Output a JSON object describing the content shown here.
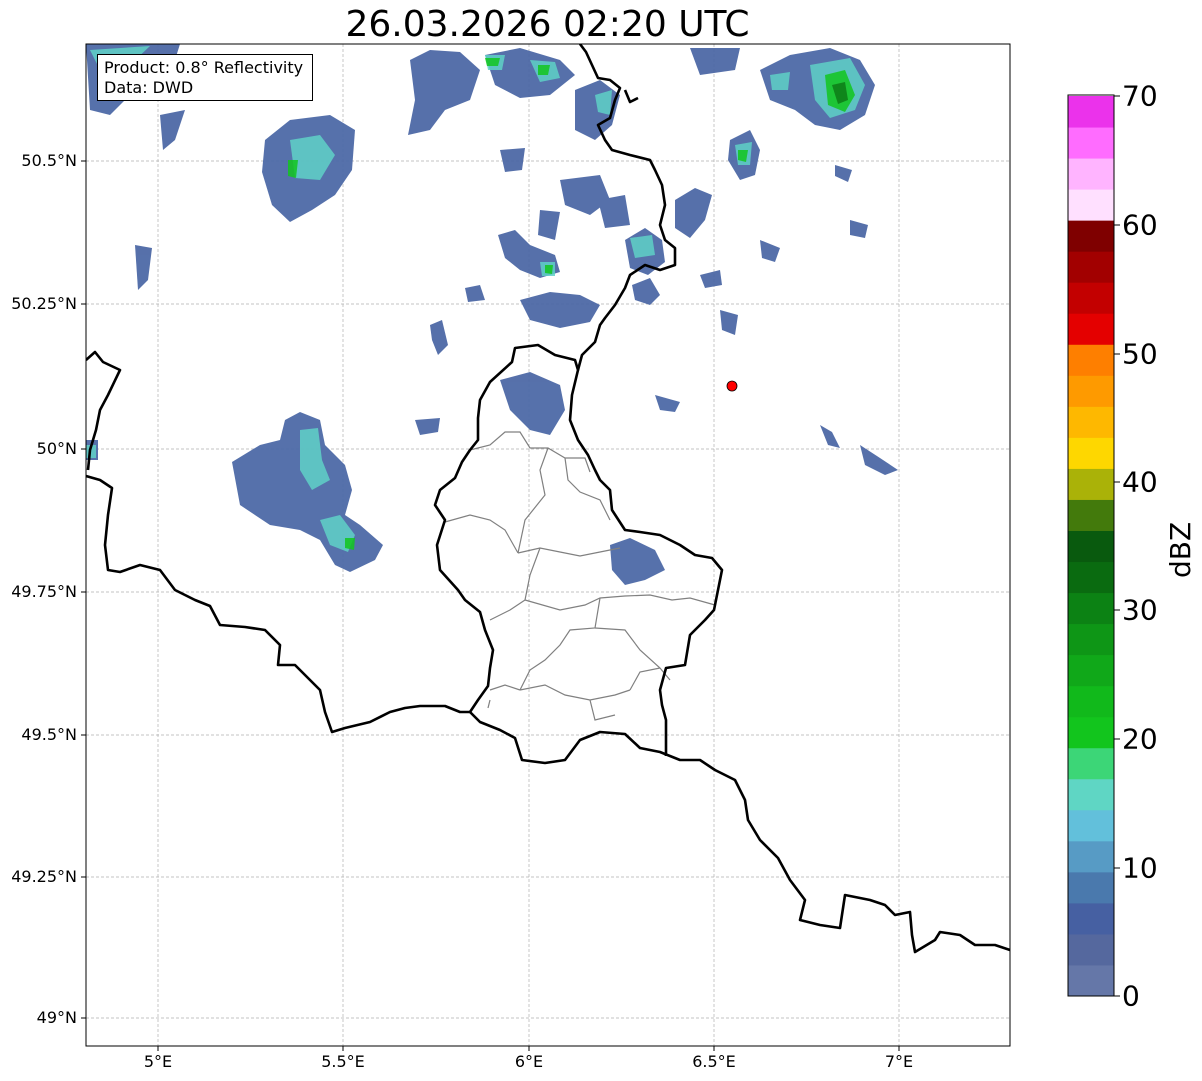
{
  "title": "26.03.2026 02:20 UTC",
  "info": {
    "product": "Product: 0.8° Reflectivity",
    "data": "Data: DWD"
  },
  "axes": {
    "x_ticks": [
      "5°E",
      "5.5°E",
      "6°E",
      "6.5°E",
      "7°E"
    ],
    "y_ticks": [
      "50.5°N",
      "50.25°N",
      "50°N",
      "49.75°N",
      "49.5°N",
      "49.25°N",
      "49°N"
    ]
  },
  "colorbar": {
    "label": "dBZ",
    "ticks": [
      "70",
      "60",
      "50",
      "40",
      "30",
      "20",
      "10",
      "0"
    ],
    "colors": [
      "#6577a8",
      "#55689e",
      "#4660a2",
      "#4a79ad",
      "#579bc5",
      "#62c0db",
      "#5fd6c4",
      "#3cd677",
      "#12c51d",
      "#11b91b",
      "#10a819",
      "#0e9616",
      "#0c8214",
      "#0a6b10",
      "#095a0e",
      "#437a0c",
      "#aab208",
      "#fed700",
      "#feb800",
      "#fe9a00",
      "#fe7f00",
      "#e40000",
      "#c30000",
      "#a20000",
      "#7f0000",
      "#ffe0ff",
      "#ffb4ff",
      "#ff6cff",
      "#eb32eb"
    ]
  },
  "marker": {
    "name": "station",
    "color": "#ff0000"
  }
}
